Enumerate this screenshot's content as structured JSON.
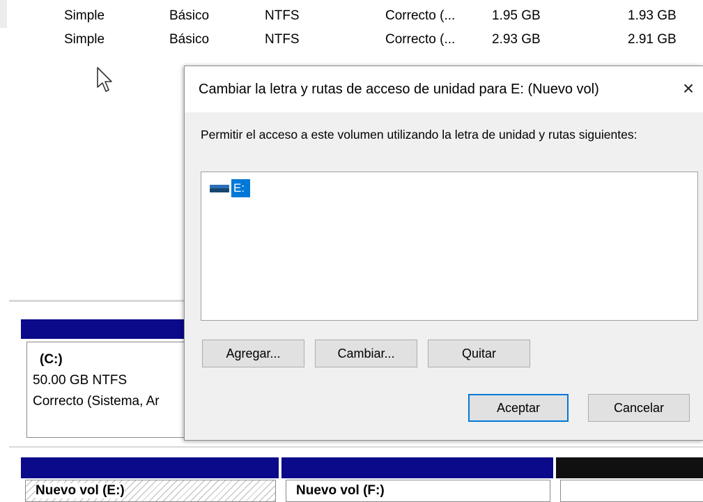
{
  "volume_rows": [
    {
      "layout": "Simple",
      "type": "Básico",
      "fs": "NTFS",
      "status": "Correcto (...",
      "capacity": "1.95 GB",
      "free": "1.93 GB"
    },
    {
      "layout": "Simple",
      "type": "Básico",
      "fs": "NTFS",
      "status": "Correcto (...",
      "capacity": "2.93 GB",
      "free": "2.91 GB"
    }
  ],
  "disk": {
    "name": "(C:)",
    "size": "50.00 GB NTFS",
    "status": "Correcto (Sistema, Ar"
  },
  "partitions": [
    {
      "label": "Nuevo vol (E:)"
    },
    {
      "label": "Nuevo vol (F:)"
    }
  ],
  "dialog": {
    "title": "Cambiar la letra y rutas de acceso de unidad para E: (Nuevo vol)",
    "close_icon": "×",
    "description": "Permitir el acceso a este volumen utilizando la letra de unidad y rutas siguientes:",
    "list_items": [
      {
        "label": "E:",
        "icon": "drive-icon",
        "selected": true
      }
    ],
    "buttons": {
      "add": "Agregar...",
      "change": "Cambiar...",
      "remove": "Quitar",
      "ok": "Aceptar",
      "cancel": "Cancelar"
    }
  },
  "colors": {
    "accent": "#0078d7",
    "disk_header": "#0a0a8a"
  }
}
